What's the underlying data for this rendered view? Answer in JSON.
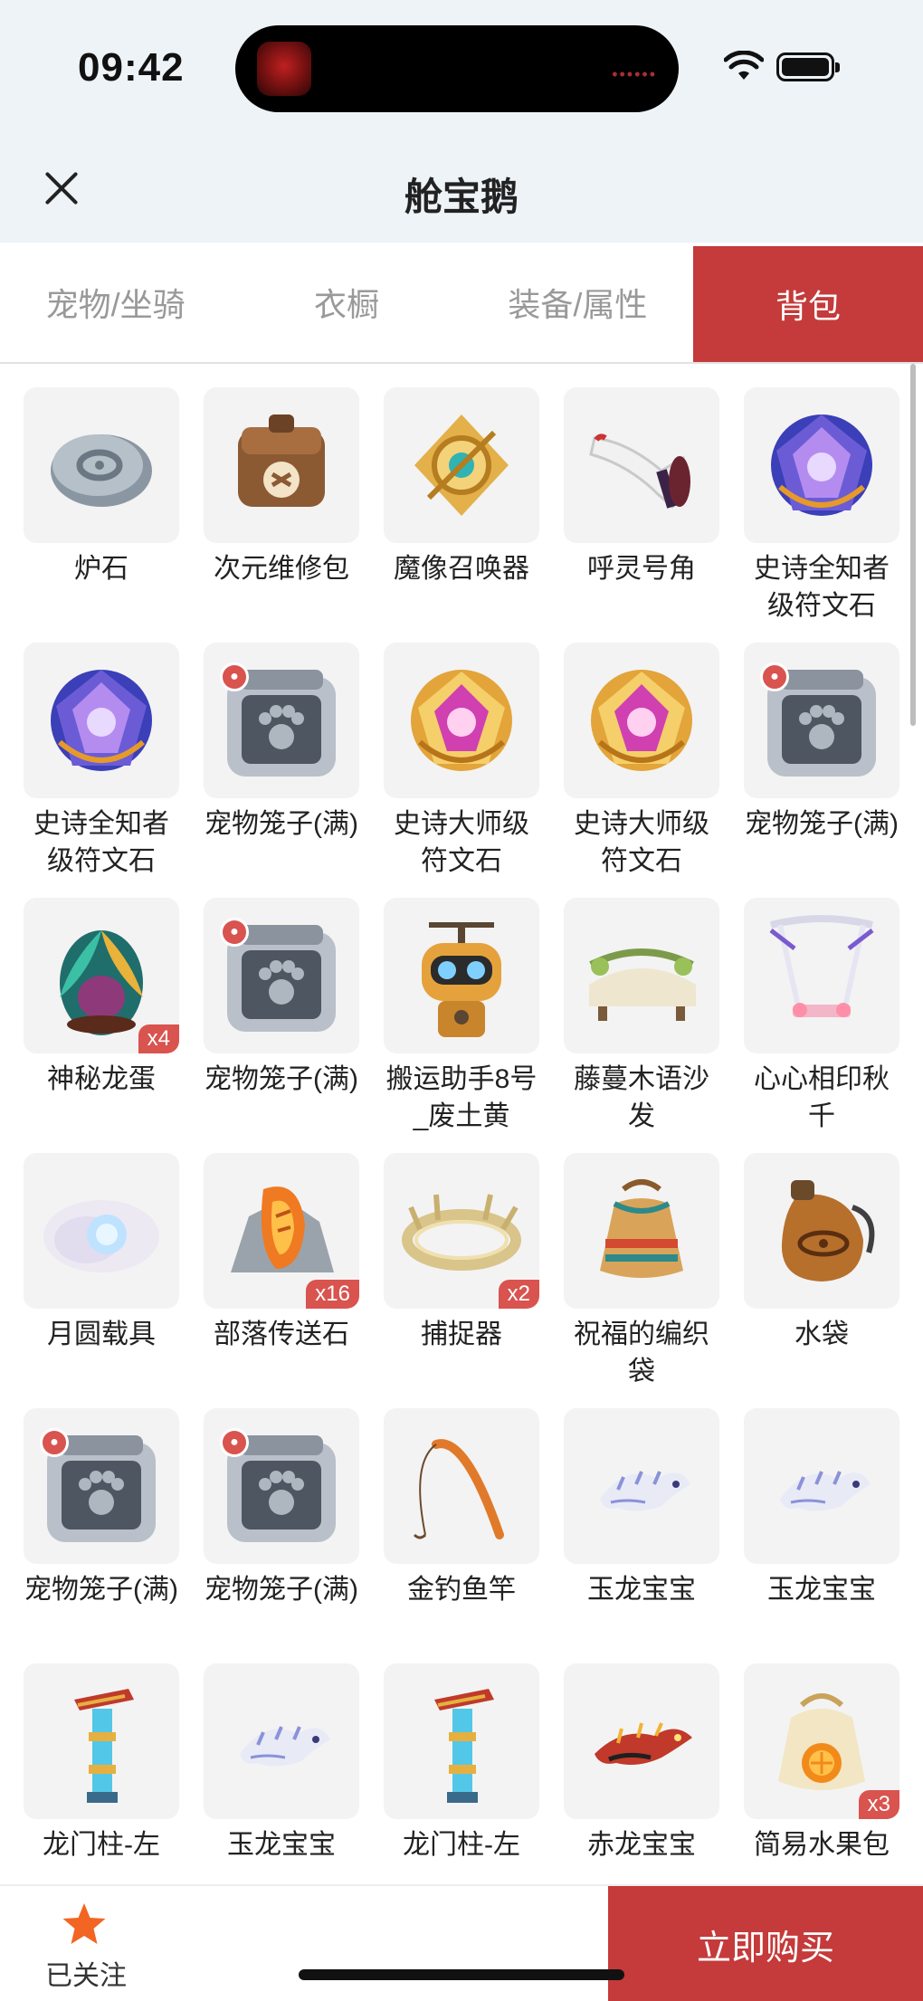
{
  "status_bar": {
    "time": "09:42"
  },
  "header": {
    "title": "舱宝鹅"
  },
  "tabs": [
    {
      "label": "宠物/坐骑",
      "active": false
    },
    {
      "label": "衣橱",
      "active": false
    },
    {
      "label": "装备/属性",
      "active": false
    },
    {
      "label": "背包",
      "active": true
    }
  ],
  "items": [
    {
      "name": "炉石",
      "icon": "stone-icon"
    },
    {
      "name": "次元维修包",
      "icon": "repair-bag-icon"
    },
    {
      "name": "魔像召唤器",
      "icon": "golem-summoner-icon"
    },
    {
      "name": "呼灵号角",
      "icon": "horn-icon"
    },
    {
      "name": "史诗全知者级符文石",
      "icon": "rune-stone-blue-icon"
    },
    {
      "name": "史诗全知者级符文石",
      "icon": "rune-stone-blue-icon"
    },
    {
      "name": "宠物笼子(满)",
      "icon": "pet-cage-icon"
    },
    {
      "name": "史诗大师级符文石",
      "icon": "rune-stone-gold-icon"
    },
    {
      "name": "史诗大师级符文石",
      "icon": "rune-stone-gold-icon"
    },
    {
      "name": "宠物笼子(满)",
      "icon": "pet-cage-icon"
    },
    {
      "name": "神秘龙蛋",
      "icon": "dragon-egg-icon",
      "count": "x4"
    },
    {
      "name": "宠物笼子(满)",
      "icon": "pet-cage-icon"
    },
    {
      "name": "搬运助手8号_废土黄",
      "icon": "robot-helper-icon"
    },
    {
      "name": "藤蔓木语沙发",
      "icon": "sofa-icon"
    },
    {
      "name": "心心相印秋千",
      "icon": "swing-icon"
    },
    {
      "name": "月圆载具",
      "icon": "moon-vehicle-icon"
    },
    {
      "name": "部落传送石",
      "icon": "teleport-stone-icon",
      "count": "x16"
    },
    {
      "name": "捕捉器",
      "icon": "catcher-icon",
      "count": "x2"
    },
    {
      "name": "祝福的编织袋",
      "icon": "woven-bag-icon"
    },
    {
      "name": "水袋",
      "icon": "water-bag-icon"
    },
    {
      "name": "宠物笼子(满)",
      "icon": "pet-cage-icon"
    },
    {
      "name": "宠物笼子(满)",
      "icon": "pet-cage-icon"
    },
    {
      "name": "金钓鱼竿",
      "icon": "fishing-rod-icon"
    },
    {
      "name": "玉龙宝宝",
      "icon": "jade-dragon-icon"
    },
    {
      "name": "玉龙宝宝",
      "icon": "jade-dragon-icon"
    },
    {
      "name": "龙门柱-左",
      "icon": "dragon-gate-pillar-icon"
    },
    {
      "name": "玉龙宝宝",
      "icon": "jade-dragon-icon"
    },
    {
      "name": "龙门柱-左",
      "icon": "dragon-gate-pillar-icon"
    },
    {
      "name": "赤龙宝宝",
      "icon": "red-dragon-icon"
    },
    {
      "name": "简易水果包",
      "icon": "fruit-bag-icon",
      "count": "x3"
    }
  ],
  "bottom": {
    "follow_label": "已关注",
    "buy_label": "立即购买"
  },
  "colors": {
    "accent": "#c53a3a",
    "badge": "#d9534f",
    "header_bg": "#edf3f7"
  }
}
